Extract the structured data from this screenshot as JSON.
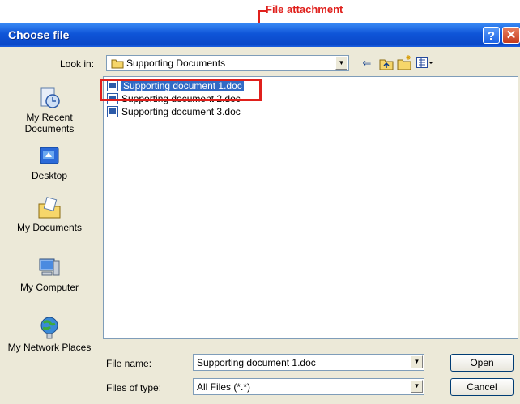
{
  "annotation": {
    "label": "File attachment"
  },
  "dialog": {
    "title": "Choose file",
    "help_glyph": "?",
    "close_glyph": "✕"
  },
  "look_in": {
    "label": "Look in:",
    "value": "Supporting Documents"
  },
  "toolbar": {
    "icons": [
      "back-icon",
      "up-folder-icon",
      "new-folder-icon",
      "view-menu-icon"
    ]
  },
  "places": [
    {
      "label": "My Recent Documents",
      "icon": "recent-documents-icon"
    },
    {
      "label": "Desktop",
      "icon": "desktop-icon"
    },
    {
      "label": "My Documents",
      "icon": "my-documents-icon"
    },
    {
      "label": "My Computer",
      "icon": "my-computer-icon"
    },
    {
      "label": "My Network Places",
      "icon": "network-places-icon"
    }
  ],
  "files": [
    {
      "name": "Supporting document 1.doc",
      "selected": true
    },
    {
      "name": "Supporting document 2.doc",
      "selected": false
    },
    {
      "name": "Supporting document 3.doc",
      "selected": false
    }
  ],
  "file_name": {
    "label": "File name:",
    "value": "Supporting document 1.doc"
  },
  "file_type": {
    "label": "Files of type:",
    "value": "All Files (*.*)"
  },
  "buttons": {
    "open": "Open",
    "cancel": "Cancel"
  },
  "colors": {
    "title_bar": "#0a48c8",
    "selection": "#316ac5",
    "annotation": "#e0201c",
    "dialog_bg": "#ece9d8"
  }
}
